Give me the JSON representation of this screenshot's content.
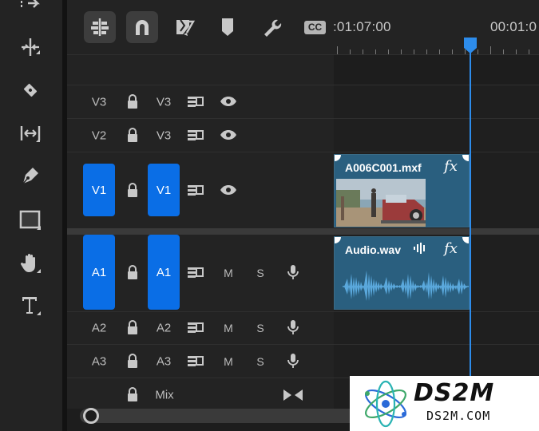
{
  "header": {
    "timecode_current": ":01:07:00",
    "timecode_next": "00:01:0",
    "buttons": [
      "insert-and-overwrite-sequences-icon",
      "snap-magnet-icon",
      "linked-selection-icon",
      "add-marker-icon",
      "timeline-settings-wrench-icon",
      "captions-icon"
    ],
    "captions_badge": "CC"
  },
  "tools": [
    "track-select-forward-icon",
    "ripple-edit-icon",
    "razor-icon",
    "slip-icon",
    "pen-icon",
    "rectangle-icon",
    "hand-icon",
    "type-icon"
  ],
  "tracks": {
    "video": [
      {
        "source": "V3",
        "target": "V3",
        "active": false
      },
      {
        "source": "V2",
        "target": "V3",
        "active": false
      },
      {
        "source": "V1",
        "target": "V1",
        "active": true
      }
    ],
    "audio": [
      {
        "source": "A1",
        "target": "A1",
        "active": true,
        "mute": "M",
        "solo": "S"
      },
      {
        "source": "A2",
        "target": "A2",
        "active": false,
        "mute": "M",
        "solo": "S"
      },
      {
        "source": "A3",
        "target": "A3",
        "active": false,
        "mute": "M",
        "solo": "S"
      }
    ],
    "mix": {
      "label": "Mix"
    }
  },
  "clips": {
    "video": {
      "name": "A006C001.mxf",
      "fx": "fx"
    },
    "audio": {
      "name": "Audio.wav",
      "fx": "fx"
    }
  },
  "watermark": {
    "title": "DS2M",
    "subtitle": "DS2M.COM"
  },
  "colors": {
    "accent": "#0a6ee6",
    "playhead": "#2d8ceb",
    "clip": "#2a5f7f",
    "panel": "#232323"
  }
}
